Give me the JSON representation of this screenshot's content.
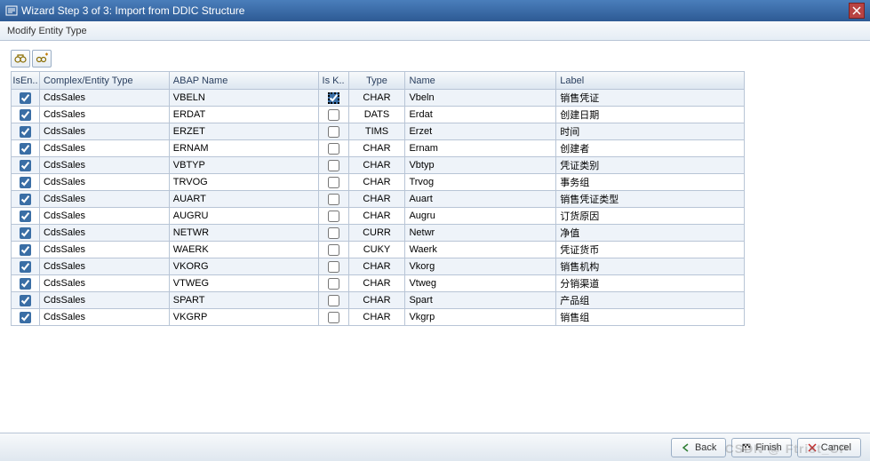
{
  "title": "Wizard Step 3 of 3: Import from DDIC Structure",
  "subtitle": "Modify Entity Type",
  "toolbar": {
    "findIcon": "binoculars-icon",
    "findNextIcon": "binoculars-plus-icon"
  },
  "columns": {
    "isen": "IsEn..",
    "entity": "Complex/Entity Type",
    "abap": "ABAP Name",
    "isk": "Is K..",
    "type": "Type",
    "name": "Name",
    "label": "Label"
  },
  "rows": [
    {
      "isen": true,
      "entity": "CdsSales",
      "abap": "VBELN",
      "isk": true,
      "iskSelected": true,
      "type": "CHAR",
      "name": "Vbeln",
      "label": "销售凭证"
    },
    {
      "isen": true,
      "entity": "CdsSales",
      "abap": "ERDAT",
      "isk": false,
      "type": "DATS",
      "name": "Erdat",
      "label": "创建日期"
    },
    {
      "isen": true,
      "entity": "CdsSales",
      "abap": "ERZET",
      "isk": false,
      "type": "TIMS",
      "name": "Erzet",
      "label": "时间"
    },
    {
      "isen": true,
      "entity": "CdsSales",
      "abap": "ERNAM",
      "isk": false,
      "type": "CHAR",
      "name": "Ernam",
      "label": "创建者"
    },
    {
      "isen": true,
      "entity": "CdsSales",
      "abap": "VBTYP",
      "isk": false,
      "type": "CHAR",
      "name": "Vbtyp",
      "label": "凭证类别"
    },
    {
      "isen": true,
      "entity": "CdsSales",
      "abap": "TRVOG",
      "isk": false,
      "type": "CHAR",
      "name": "Trvog",
      "label": "事务组"
    },
    {
      "isen": true,
      "entity": "CdsSales",
      "abap": "AUART",
      "isk": false,
      "type": "CHAR",
      "name": "Auart",
      "label": "销售凭证类型"
    },
    {
      "isen": true,
      "entity": "CdsSales",
      "abap": "AUGRU",
      "isk": false,
      "type": "CHAR",
      "name": "Augru",
      "label": "订货原因"
    },
    {
      "isen": true,
      "entity": "CdsSales",
      "abap": "NETWR",
      "isk": false,
      "type": "CURR",
      "name": "Netwr",
      "label": "净值"
    },
    {
      "isen": true,
      "entity": "CdsSales",
      "abap": "WAERK",
      "isk": false,
      "type": "CUKY",
      "name": "Waerk",
      "label": "凭证货币"
    },
    {
      "isen": true,
      "entity": "CdsSales",
      "abap": "VKORG",
      "isk": false,
      "type": "CHAR",
      "name": "Vkorg",
      "label": "销售机构"
    },
    {
      "isen": true,
      "entity": "CdsSales",
      "abap": "VTWEG",
      "isk": false,
      "type": "CHAR",
      "name": "Vtweg",
      "label": "分销渠道"
    },
    {
      "isen": true,
      "entity": "CdsSales",
      "abap": "SPART",
      "isk": false,
      "type": "CHAR",
      "name": "Spart",
      "label": "产品组"
    },
    {
      "isen": true,
      "entity": "CdsSales",
      "abap": "VKGRP",
      "isk": false,
      "type": "CHAR",
      "name": "Vkgrp",
      "label": "销售组"
    }
  ],
  "footer": {
    "back": "Back",
    "finish": "Finish",
    "cancel": "Cancel"
  },
  "watermark": "CSDN @ Ftrist_CP"
}
